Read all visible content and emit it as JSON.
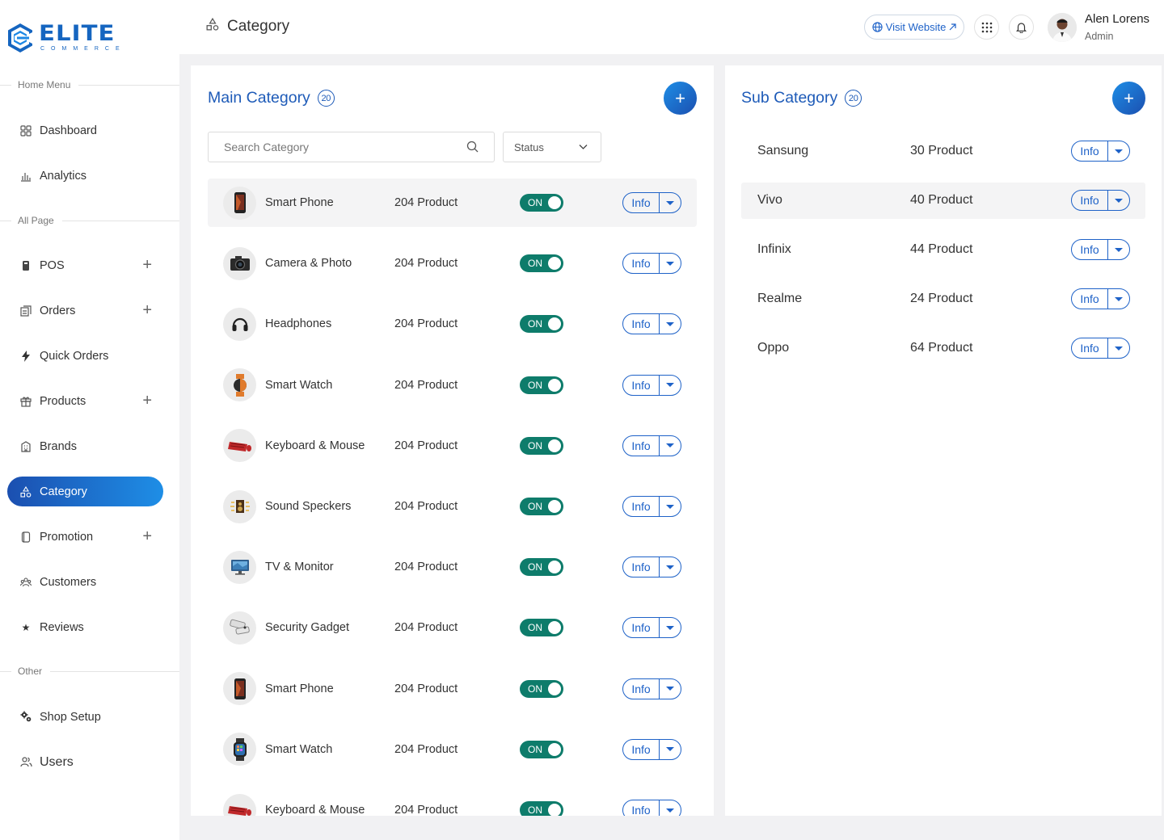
{
  "brand": {
    "name": "ELITE",
    "tagline": "COMMERCE"
  },
  "sidebar": {
    "sections": {
      "home": "Home Menu",
      "all": "All Page",
      "other": "Other"
    },
    "items": [
      {
        "label": "Dashboard",
        "icon": "dashboard-icon"
      },
      {
        "label": "Analytics",
        "icon": "analytics-icon"
      },
      {
        "label": "POS",
        "icon": "pos-icon",
        "expand": "+"
      },
      {
        "label": "Orders",
        "icon": "orders-icon",
        "expand": "+"
      },
      {
        "label": "Quick Orders",
        "icon": "bolt-icon"
      },
      {
        "label": "Products",
        "icon": "gift-icon",
        "expand": "+"
      },
      {
        "label": "Brands",
        "icon": "building-icon"
      },
      {
        "label": "Category",
        "icon": "shapes-icon",
        "active": true
      },
      {
        "label": "Promotion",
        "icon": "promotion-icon",
        "expand": "+"
      },
      {
        "label": "Customers",
        "icon": "customers-icon"
      },
      {
        "label": "Reviews",
        "icon": "star-icon"
      },
      {
        "label": "Shop Setup",
        "icon": "gears-icon"
      },
      {
        "label": "Users",
        "icon": "users-icon"
      }
    ]
  },
  "header": {
    "title": "Category",
    "visit_label": "Visit Website",
    "user_name": "Alen Lorens",
    "user_role": "Admin"
  },
  "main_category": {
    "title": "Main Category",
    "count": "20",
    "add_label": "+",
    "search_placeholder": "Search Category",
    "status_label": "Status",
    "rows": [
      {
        "name": "Smart Phone",
        "count": "204 Product",
        "toggle": "ON",
        "action": "Info",
        "thumb": "phone"
      },
      {
        "name": "Camera & Photo",
        "count": "204 Product",
        "toggle": "ON",
        "action": "Info",
        "thumb": "camera"
      },
      {
        "name": "Headphones",
        "count": "204 Product",
        "toggle": "ON",
        "action": "Info",
        "thumb": "headphones"
      },
      {
        "name": "Smart Watch",
        "count": "204 Product",
        "toggle": "ON",
        "action": "Info",
        "thumb": "watch-orange"
      },
      {
        "name": "Keyboard & Mouse",
        "count": "204 Product",
        "toggle": "ON",
        "action": "Info",
        "thumb": "keyboard"
      },
      {
        "name": "Sound Speckers",
        "count": "204 Product",
        "toggle": "ON",
        "action": "Info",
        "thumb": "speaker"
      },
      {
        "name": "TV & Monitor",
        "count": "204 Product",
        "toggle": "ON",
        "action": "Info",
        "thumb": "monitor"
      },
      {
        "name": "Security Gadget",
        "count": "204 Product",
        "toggle": "ON",
        "action": "Info",
        "thumb": "cctv"
      },
      {
        "name": "Smart Phone",
        "count": "204 Product",
        "toggle": "ON",
        "action": "Info",
        "thumb": "phone"
      },
      {
        "name": "Smart Watch",
        "count": "204 Product",
        "toggle": "ON",
        "action": "Info",
        "thumb": "watch-dark"
      },
      {
        "name": "Keyboard & Mouse",
        "count": "204 Product",
        "toggle": "ON",
        "action": "Info",
        "thumb": "keyboard"
      }
    ]
  },
  "sub_category": {
    "title": "Sub Category",
    "count": "20",
    "add_label": "+",
    "rows": [
      {
        "name": "Sansung",
        "count": "30 Product",
        "action": "Info"
      },
      {
        "name": "Vivo",
        "count": "40 Product",
        "action": "Info"
      },
      {
        "name": "Infinix",
        "count": "44 Product",
        "action": "Info"
      },
      {
        "name": "Realme",
        "count": "24 Product",
        "action": "Info"
      },
      {
        "name": "Oppo",
        "count": "64 Product",
        "action": "Info"
      }
    ]
  },
  "colors": {
    "accent": "#1e62c8",
    "toggle_on": "#0e7c6b",
    "gradient_start": "#1b4fb0",
    "gradient_end": "#1e8ee6"
  }
}
